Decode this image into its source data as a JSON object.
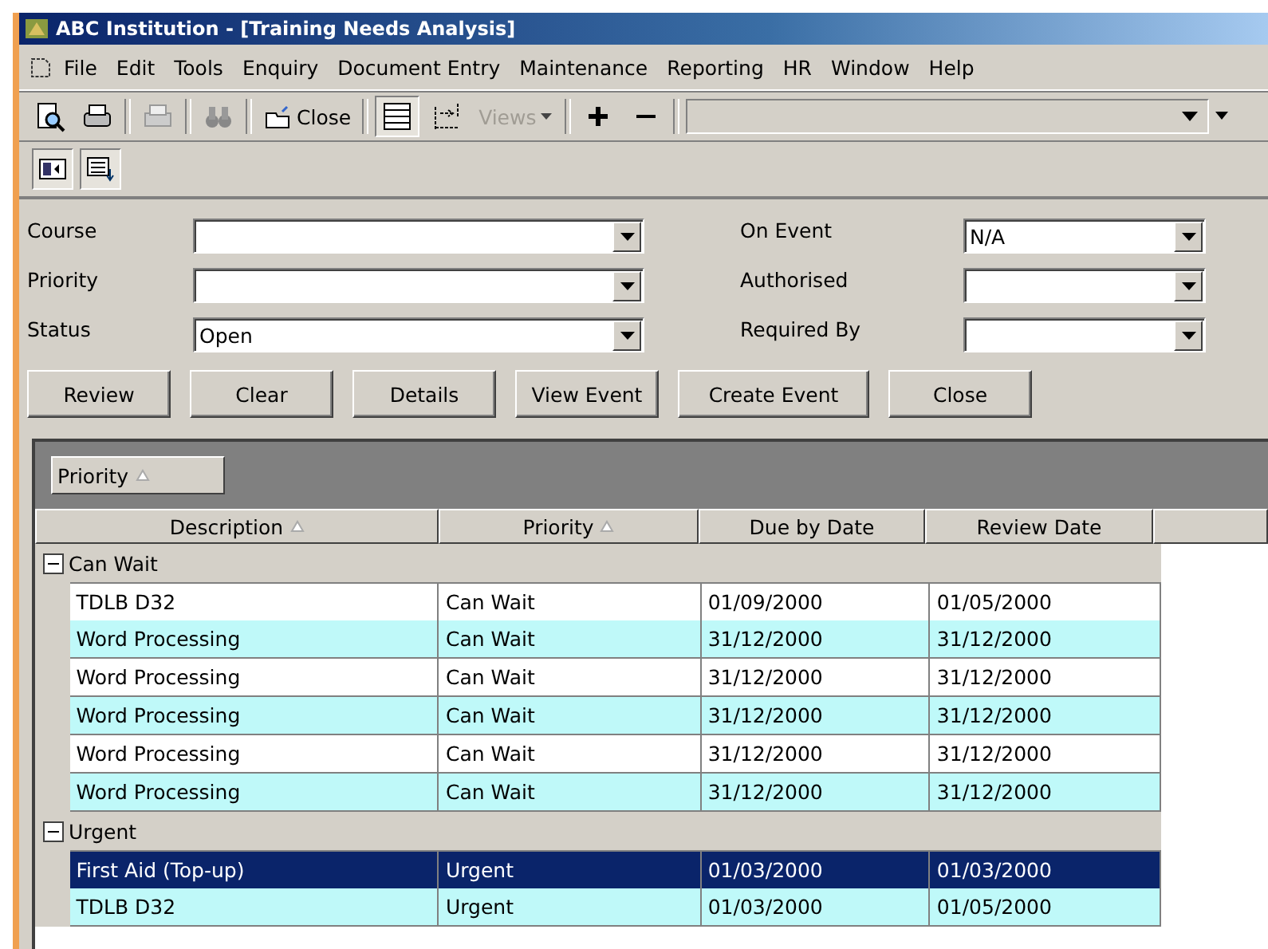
{
  "window": {
    "title": "ABC Institution - [Training Needs Analysis]"
  },
  "menu": [
    {
      "label": "File"
    },
    {
      "label": "Edit"
    },
    {
      "label": "Tools"
    },
    {
      "label": "Enquiry"
    },
    {
      "label": "Document Entry"
    },
    {
      "label": "Maintenance"
    },
    {
      "label": "Reporting"
    },
    {
      "label": "HR"
    },
    {
      "label": "Window"
    },
    {
      "label": "Help"
    }
  ],
  "toolbar": {
    "close_label": "Close",
    "views_label": "Views",
    "views_disabled": true
  },
  "filters_left": [
    {
      "label": "Course"
    },
    {
      "label": "Priority"
    },
    {
      "label": "Status",
      "value": "Open"
    }
  ],
  "filters_right": [
    {
      "label": "On Event",
      "value": "N/A"
    },
    {
      "label": "Authorised"
    },
    {
      "label": "Required By"
    }
  ],
  "buttons": [
    {
      "label": "Review"
    },
    {
      "label": "Clear"
    },
    {
      "label": "Details"
    },
    {
      "label": "View Event"
    },
    {
      "label": "Create Event"
    },
    {
      "label": "Close"
    }
  ],
  "grid": {
    "group_by": {
      "label": "Priority",
      "sorted": true
    },
    "columns": [
      {
        "label": "Description",
        "sorted": true
      },
      {
        "label": "Priority",
        "sorted": true
      },
      {
        "label": "Due by Date",
        "sorted": false
      },
      {
        "label": "Review Date",
        "sorted": false
      }
    ],
    "groups": [
      {
        "label": "Can Wait",
        "expanded": true,
        "rows": [
          {
            "cells": [
              "TDLB D32",
              "Can Wait",
              "01/09/2000",
              "01/05/2000"
            ],
            "selected": false
          },
          {
            "cells": [
              "Word Processing",
              "Can Wait",
              "31/12/2000",
              "31/12/2000"
            ],
            "selected": false
          },
          {
            "cells": [
              "Word Processing",
              "Can Wait",
              "31/12/2000",
              "31/12/2000"
            ],
            "selected": false
          },
          {
            "cells": [
              "Word Processing",
              "Can Wait",
              "31/12/2000",
              "31/12/2000"
            ],
            "selected": false
          },
          {
            "cells": [
              "Word Processing",
              "Can Wait",
              "31/12/2000",
              "31/12/2000"
            ],
            "selected": false
          },
          {
            "cells": [
              "Word Processing",
              "Can Wait",
              "31/12/2000",
              "31/12/2000"
            ],
            "selected": false
          }
        ]
      },
      {
        "label": "Urgent",
        "expanded": true,
        "rows": [
          {
            "cells": [
              "First Aid (Top-up)",
              "Urgent",
              "01/03/2000",
              "01/03/2000"
            ],
            "selected": true
          },
          {
            "cells": [
              "TDLB D32",
              "Urgent",
              "01/03/2000",
              "01/05/2000"
            ],
            "selected": false
          }
        ]
      }
    ]
  }
}
